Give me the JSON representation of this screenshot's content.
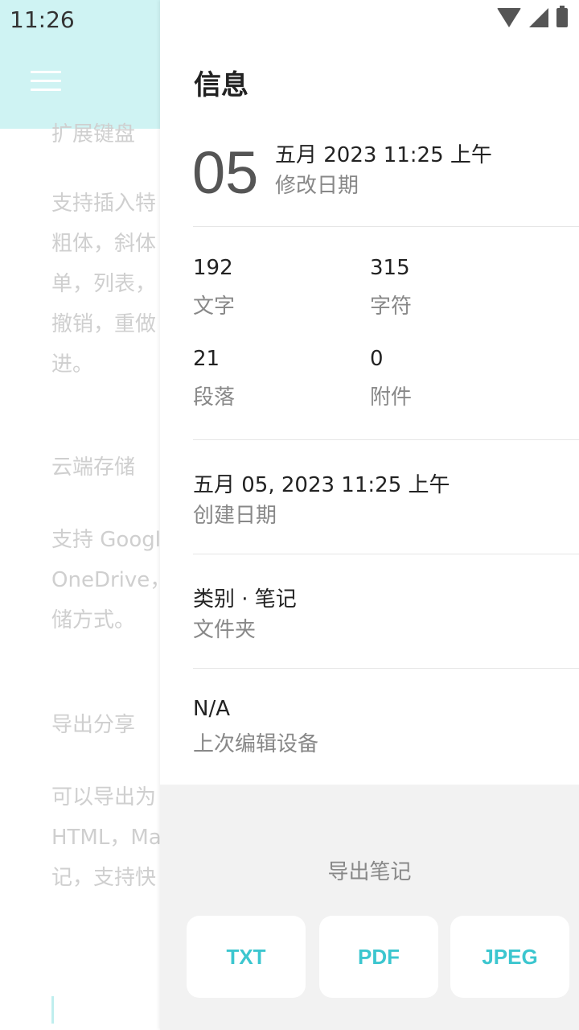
{
  "status_bar": {
    "time": "11:26"
  },
  "background_editor": {
    "paragraphs": [
      "扩展键盘",
      "支持插入特",
      "粗体，斜体",
      "单，列表，",
      "撤销，重做",
      "进。",
      "云端存储",
      "支持 Googl",
      "OneDrive，",
      "储方式。",
      "导出分享",
      "可以导出为",
      "HTML，Ma",
      "记，支持快"
    ]
  },
  "info_panel": {
    "title": "信息",
    "day": "05",
    "modified_date": "五月 2023 11:25 上午",
    "modified_label": "修改日期",
    "stats": [
      {
        "value": "192",
        "label": "文字"
      },
      {
        "value": "315",
        "label": "字符"
      },
      {
        "value": "21",
        "label": "段落"
      },
      {
        "value": "0",
        "label": "附件"
      }
    ],
    "created": {
      "value": "五月 05, 2023 11:25 上午",
      "label": "创建日期"
    },
    "folder": {
      "value": "类别 · 笔记",
      "label": "文件夹"
    },
    "device": {
      "value": "N/A",
      "label": "上次编辑设备"
    },
    "export": {
      "title": "导出笔记",
      "buttons": [
        "TXT",
        "PDF",
        "JPEG"
      ]
    }
  },
  "colors": {
    "accent": "#3cc6cf",
    "header_bg": "#cff3f3"
  },
  "icons": [
    "menu-icon",
    "wifi-icon",
    "signal-icon",
    "battery-icon"
  ]
}
